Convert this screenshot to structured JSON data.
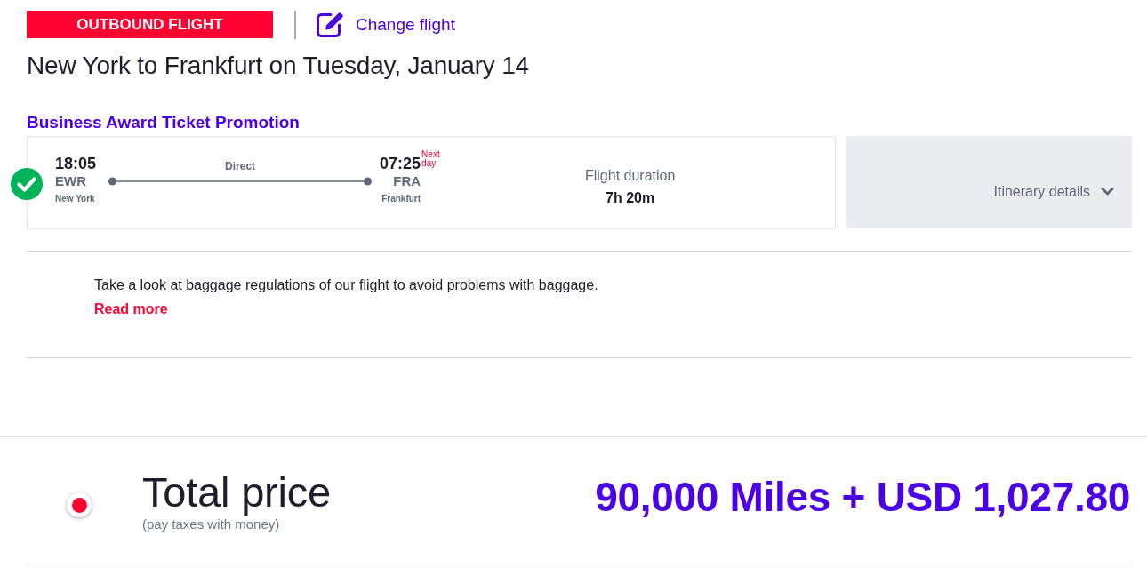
{
  "header": {
    "badge": "OUTBOUND FLIGHT",
    "change_link": "Change flight"
  },
  "title": "New York to Frankfurt on Tuesday, January 14",
  "fare_name": "Business Award Ticket Promotion",
  "flight": {
    "selected": true,
    "departure": {
      "time": "18:05",
      "code": "EWR",
      "city": "New York"
    },
    "stops": "Direct",
    "arrival": {
      "time": "07:25",
      "day_note": "Next day",
      "code": "FRA",
      "city": "Frankfurt"
    },
    "duration_label": "Flight duration",
    "duration": "7h 20m"
  },
  "itinerary_toggle": {
    "label": "Itinerary details",
    "expanded": false
  },
  "baggage": {
    "text": "Take a look at baggage regulations of our flight to avoid problems with baggage.",
    "link": "Read more"
  },
  "total": {
    "selected": true,
    "label": "Total price",
    "note": "(pay taxes with money)",
    "price": "90,000 Miles + USD 1,027.80"
  }
}
